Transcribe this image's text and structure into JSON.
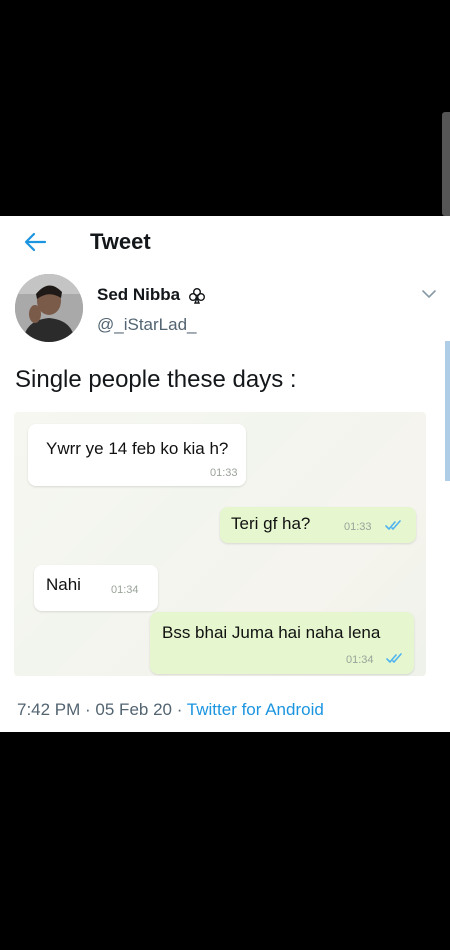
{
  "header": {
    "title": "Tweet"
  },
  "author": {
    "name": "Sed Nibba",
    "handle": "@_iStarLad_"
  },
  "tweet": {
    "text": "Single people these days :"
  },
  "chat": {
    "messages": [
      {
        "text": "Ywrr ye 14 feb ko kia h?",
        "time": "01:33",
        "direction": "incoming"
      },
      {
        "text": "Teri gf ha?",
        "time": "01:33",
        "direction": "outgoing"
      },
      {
        "text": "Nahi",
        "time": "01:34",
        "direction": "incoming"
      },
      {
        "text": "Bss bhai Juma hai naha lena",
        "time": "01:34",
        "direction": "outgoing"
      }
    ]
  },
  "meta": {
    "time": "7:42 PM",
    "sep1": " · ",
    "date": "05 Feb 20",
    "sep2": " · ",
    "source": "Twitter for Android"
  },
  "icons": {
    "back": "arrow-left-icon",
    "badge": "club-icon",
    "more": "chevron-down-icon",
    "read": "double-check-icon"
  },
  "colors": {
    "accent": "#1b95e0",
    "outgoing_bubble": "#e6f7cf",
    "read_tick": "#4fb3f0"
  }
}
